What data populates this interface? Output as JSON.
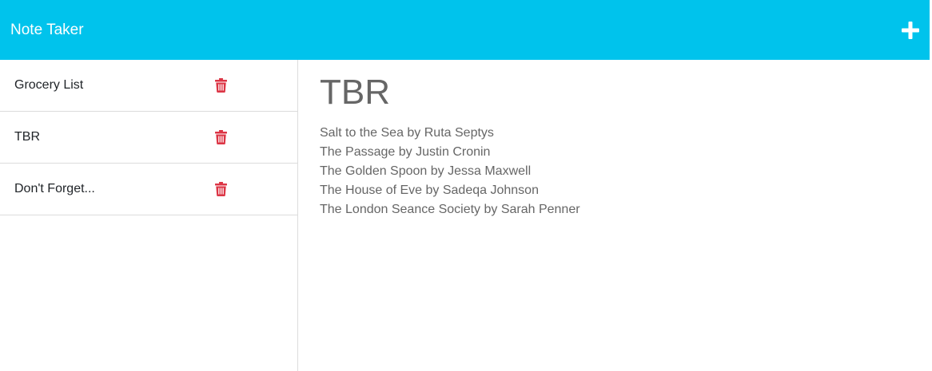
{
  "navbar": {
    "title": "Note Taker",
    "add_icon": "plus-icon",
    "color": "#00c3ec"
  },
  "sidebar": {
    "notes": [
      {
        "title": "Grocery List",
        "delete_icon": "trash-icon"
      },
      {
        "title": "TBR",
        "delete_icon": "trash-icon"
      },
      {
        "title": "Don't Forget...",
        "delete_icon": "trash-icon"
      }
    ],
    "delete_color": "#dc3545"
  },
  "main": {
    "note_title": "TBR",
    "note_lines": [
      "Salt to the Sea by Ruta Septys",
      "The Passage by Justin Cronin",
      "The Golden Spoon by Jessa Maxwell",
      "The House of Eve by Sadeqa Johnson",
      "The London Seance Society by Sarah Penner"
    ]
  }
}
